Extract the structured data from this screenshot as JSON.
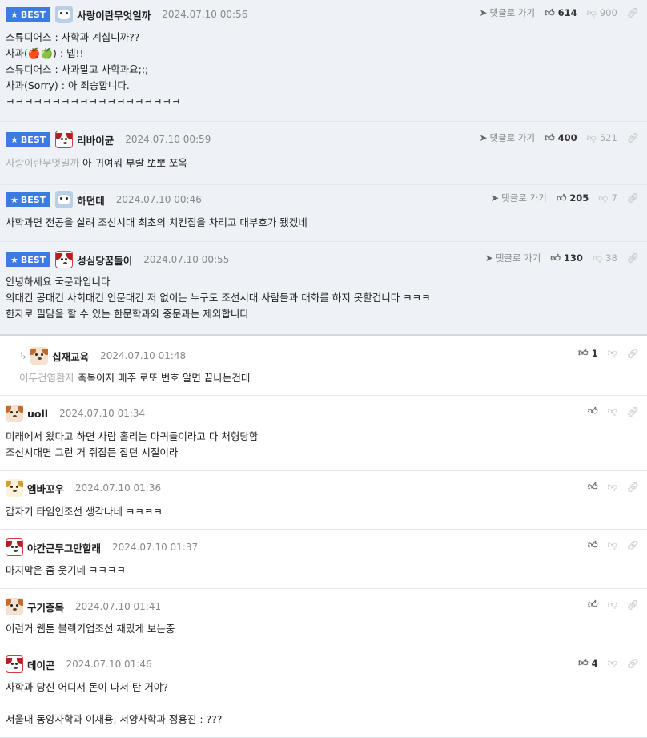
{
  "best_badge": "BEST",
  "goto_label": "댓글로 가기",
  "comments": [
    {
      "nick": "사랑이란무엇일까",
      "date": "2024.07.10 00:56",
      "likes": "614",
      "dislikes": "900",
      "lines": [
        "스튜디어스 : 사학과 계십니까??",
        "사과(🍎🍏) : 넵!!",
        "스튜디어스 : 사과말고 사학과요;;;",
        "사과(Sorry) : 아 죄송합니다.",
        "ㅋㅋㅋㅋㅋㅋㅋㅋㅋㅋㅋㅋㅋㅋㅋㅋㅋㅋㅋ"
      ]
    },
    {
      "nick": "리바이균",
      "date": "2024.07.10 00:59",
      "likes": "400",
      "dislikes": "521",
      "ref": "사랑이란무엇일까",
      "lines": [
        "아 귀여워 부랄 뽀뽀 쪼옥"
      ]
    },
    {
      "nick": "하던데",
      "date": "2024.07.10 00:46",
      "likes": "205",
      "dislikes": "7",
      "lines": [
        "사학과면 전공을 살려 조선시대 최초의 치킨집을 차리고 대부호가 됐겠네"
      ]
    },
    {
      "nick": "성심당꿈돌이",
      "date": "2024.07.10 00:55",
      "likes": "130",
      "dislikes": "38",
      "lines": [
        "안녕하세요 국문과입니다",
        "의대건 공대건 사회대건 인문대건 저 없이는 누구도 조선시대 사람들과 대화를 하지 못할겁니다 ㅋㅋㅋ",
        "한자로 필담을 할 수 있는 한문학과와 중문과는 제외합니다"
      ]
    },
    {
      "nick": "십재교육",
      "date": "2024.07.10 01:48",
      "likes": "1",
      "ref": "이두건염환자",
      "lines": [
        "축복이지 매주 로또 번호 알면 끝나는건데"
      ]
    },
    {
      "nick": "uoll",
      "date": "2024.07.10 01:34",
      "lines": [
        "미래에서 왔다고 하면 사람 홀리는 마귀들이라고 다 처형당함",
        "조선시대면 그런 거 쥐잡든 잡던 시절이라"
      ]
    },
    {
      "nick": "엠바꼬우",
      "date": "2024.07.10 01:36",
      "lines": [
        "갑자기 타임인조선 생각나네 ㅋㅋㅋㅋ"
      ]
    },
    {
      "nick": "야간근무그만할래",
      "date": "2024.07.10 01:37",
      "lines": [
        "마지막은 좀 웃기네 ㅋㅋㅋㅋ"
      ]
    },
    {
      "nick": "구기종목",
      "date": "2024.07.10 01:41",
      "lines": [
        "이런거 웹툰 블랙기업조선 재밌게 보는중"
      ]
    },
    {
      "nick": "데이곤",
      "date": "2024.07.10 01:46",
      "likes": "4",
      "lines": [
        "사학과 당신 어디서 돈이 나서 탄 거야?",
        "",
        "서울대 동양사학과 이재용, 서양사학과 정용진 : ???"
      ]
    }
  ]
}
